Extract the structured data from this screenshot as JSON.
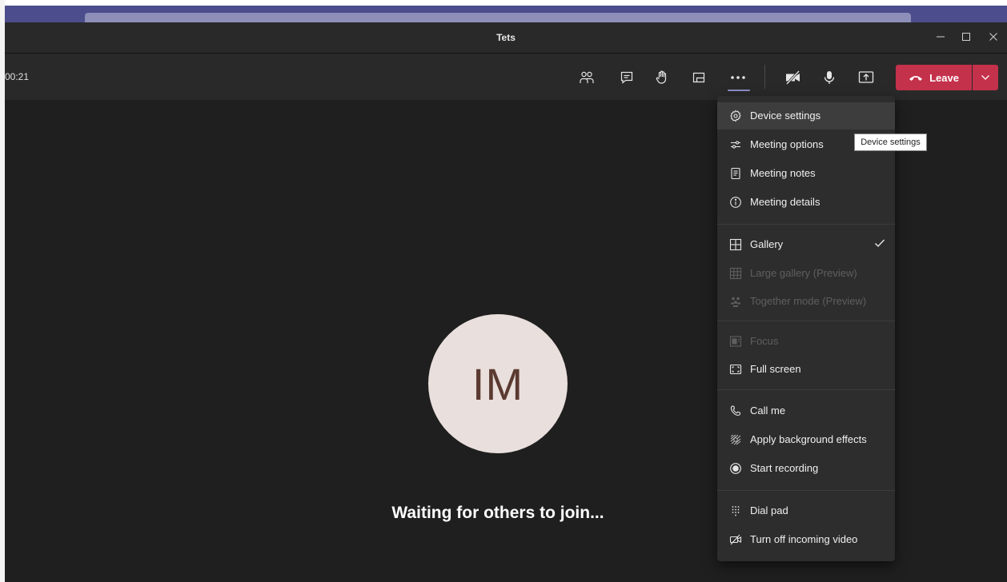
{
  "window": {
    "title": "Tets"
  },
  "toolbar": {
    "timer": "00:21",
    "leave_label": "Leave"
  },
  "stage": {
    "avatar_initials": "IM",
    "waiting_text": "Waiting for others to join..."
  },
  "menu": {
    "device_settings": "Device settings",
    "meeting_options": "Meeting options",
    "meeting_notes": "Meeting notes",
    "meeting_details": "Meeting details",
    "gallery": "Gallery",
    "large_gallery": "Large gallery (Preview)",
    "together_mode": "Together mode (Preview)",
    "focus": "Focus",
    "full_screen": "Full screen",
    "call_me": "Call me",
    "background_effects": "Apply background effects",
    "start_recording": "Start recording",
    "dial_pad": "Dial pad",
    "turn_off_incoming_video": "Turn off incoming video"
  },
  "tooltip": "Device settings",
  "colors": {
    "leave": "#c4314b",
    "accent": "#8b8cc7",
    "avatar_bg": "#e9dfdc",
    "avatar_text": "#5b3a31"
  }
}
